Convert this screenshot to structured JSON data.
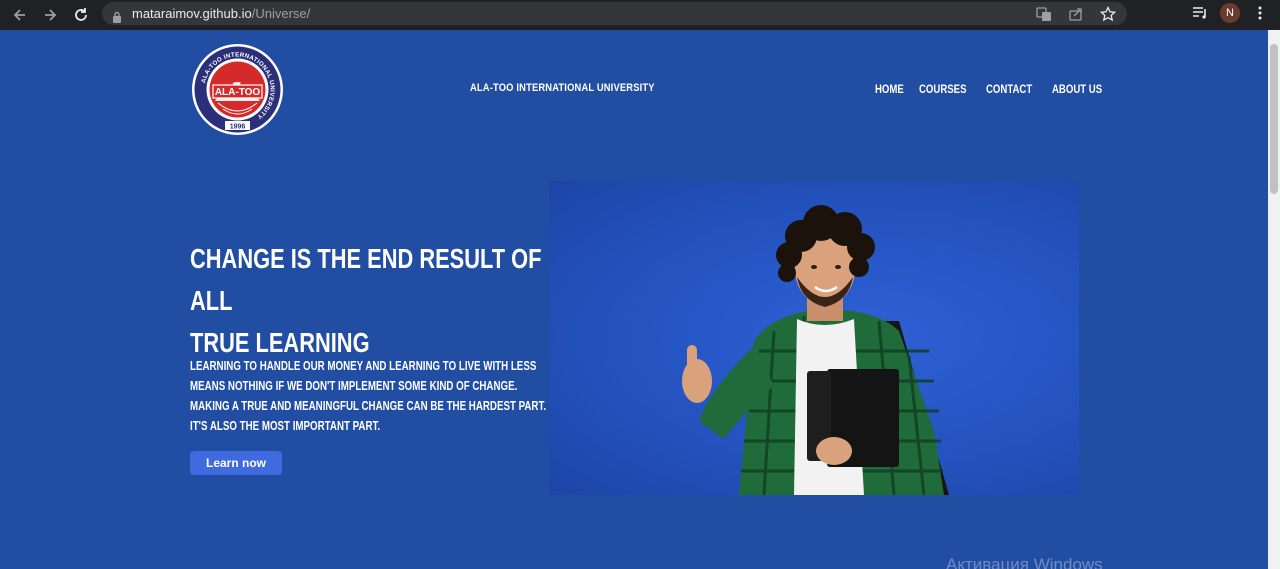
{
  "browser": {
    "url_host": "mataraimov.github.io",
    "url_path": "/Universe/",
    "profile_initial": "N"
  },
  "logo": {
    "ring_text": "ALA-TOO INTERNATIONAL UNIVERSITY",
    "name": "ALA-TOO",
    "year": "1996"
  },
  "header": {
    "brand": "ALA-TOO INTERNATIONAL UNIVERSITY",
    "nav": [
      {
        "label": "HOME"
      },
      {
        "label": "COURSES"
      },
      {
        "label": "CONTACT"
      },
      {
        "label": "ABOUT US"
      }
    ]
  },
  "hero": {
    "headline_line1": "CHANGE IS THE END RESULT OF ALL",
    "headline_line2": "TRUE LEARNING",
    "body": "LEARNING TO HANDLE OUR MONEY AND LEARNING TO LIVE WITH LESS MEANS NOTHING IF WE DON'T IMPLEMENT SOME KIND OF CHANGE. MAKING A TRUE AND MEANINGFUL CHANGE CAN BE THE HARDEST PART. IT'S ALSO THE MOST IMPORTANT PART.",
    "cta_label": "Learn now"
  },
  "overlay": {
    "watermark": "Активация Windows"
  },
  "colors": {
    "page_bg": "#214ea3",
    "button_bg": "#3f6ae0",
    "chrome_bg": "#202124",
    "logo_red": "#d42a2a",
    "logo_navy": "#2b2f7a"
  }
}
